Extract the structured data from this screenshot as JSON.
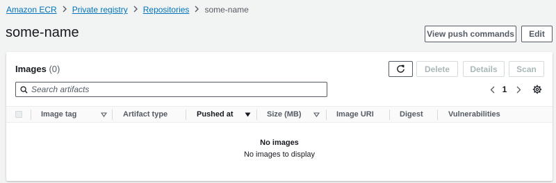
{
  "breadcrumb": {
    "items": [
      "Amazon ECR",
      "Private registry",
      "Repositories"
    ],
    "current": "some-name"
  },
  "page": {
    "title": "some-name",
    "view_push_label": "View push commands",
    "edit_label": "Edit"
  },
  "images_panel": {
    "title": "Images",
    "count": "(0)",
    "actions": {
      "refresh_icon": "refresh-icon",
      "delete": "Delete",
      "details": "Details",
      "scan": "Scan"
    },
    "search": {
      "placeholder": "Search artifacts",
      "value": "",
      "icon": "search-icon"
    },
    "pagination": {
      "page": "1"
    },
    "settings_icon": "gear-icon",
    "columns": [
      "Image tag",
      "Artifact type",
      "Pushed at",
      "Size (MB)",
      "Image URI",
      "Digest",
      "Vulnerabilities"
    ],
    "empty": {
      "title": "No images",
      "message": "No images to display"
    }
  }
}
